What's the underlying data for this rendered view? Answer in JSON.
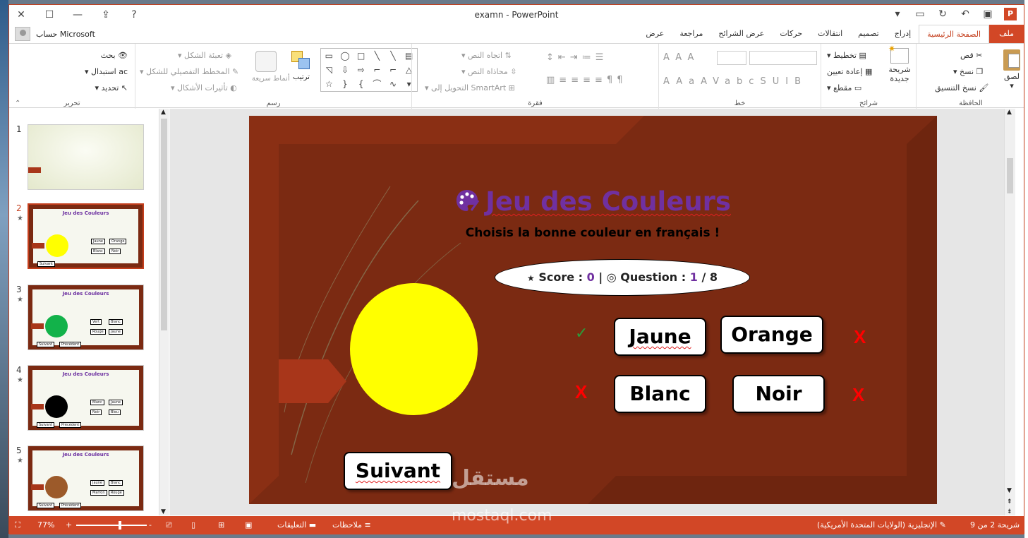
{
  "titlebar": {
    "title": "examn - PowerPoint"
  },
  "account": {
    "label": "حساب Microsoft"
  },
  "tabs": [
    {
      "label": "ملف",
      "kind": "file"
    },
    {
      "label": "الصفحة الرئيسية",
      "kind": "active"
    },
    {
      "label": "إدراج"
    },
    {
      "label": "تصميم"
    },
    {
      "label": "انتقالات"
    },
    {
      "label": "حركات"
    },
    {
      "label": "عرض الشرائح"
    },
    {
      "label": "مراجعة"
    },
    {
      "label": "عرض"
    }
  ],
  "ribbon": {
    "clipboard": {
      "label": "الحافظة",
      "paste": "لصق",
      "cut": "قص",
      "copy": "نسخ",
      "format_painter": "نسخ التنسيق"
    },
    "slides": {
      "label": "شرائح",
      "new_slide": "شريحة جديدة",
      "layout": "تخطيط",
      "reset": "إعادة تعيين",
      "section": "مقطع"
    },
    "font": {
      "label": "خط"
    },
    "paragraph": {
      "label": "فقرة",
      "text_direction": "اتجاه النص",
      "align_text": "محاذاة النص",
      "smartart": "التحويل إلى SmartArt"
    },
    "drawing": {
      "label": "رسم",
      "arrange": "ترتيب",
      "quick_styles": "أنماط سريعة",
      "shape_fill": "تعبئة الشكل",
      "shape_outline": "المخطط التفصيلي للشكل",
      "shape_effects": "تأثيرات الأشكال"
    },
    "editing": {
      "label": "تحرير",
      "find": "بحث",
      "replace": "استبدال",
      "select": "تحديد"
    }
  },
  "thumbnails": [
    {
      "num": "1",
      "star": "",
      "color": "",
      "title": "",
      "a": [],
      "buttons": []
    },
    {
      "num": "2",
      "star": "★",
      "color": "#ffff00",
      "title": "Jeu des Couleurs",
      "a": [
        "Jaune",
        "Orange",
        "Blanc",
        "Noir"
      ],
      "buttons": [
        "Suivant"
      ]
    },
    {
      "num": "3",
      "star": "★",
      "color": "#12b24a",
      "title": "Jeu des Couleurs",
      "a": [
        "Vert",
        "Blanc",
        "Rouge",
        "Jaune"
      ],
      "buttons": [
        "Suivant",
        "Précédent"
      ]
    },
    {
      "num": "4",
      "star": "★",
      "color": "#000000",
      "title": "Jeu des Couleurs",
      "a": [
        "Blanc",
        "Jaune",
        "Noir",
        "Bleu"
      ],
      "buttons": [
        "Suivant",
        "Précédent"
      ]
    },
    {
      "num": "5",
      "star": "★",
      "color": "#9c5a2a",
      "title": "Jeu des Couleurs",
      "a": [
        "Jaune",
        "Blanc",
        "Marron",
        "Rouge"
      ],
      "buttons": [
        "Suivant",
        "Précédent"
      ]
    }
  ],
  "slide": {
    "title": "Jeu des Couleurs",
    "subtitle": "Choisis la bonne couleur en français !",
    "score_label": "Score : ",
    "score_value": "0",
    "question_label": "Question : ",
    "question_current": "1",
    "question_total": "8",
    "circle_color": "#ffff00",
    "answers": {
      "a1": "Jaune",
      "a2": "Orange",
      "a3": "Blanc",
      "a4": "Noir"
    },
    "marks": {
      "check": "✓",
      "x": "X"
    },
    "next_button": "Suivant"
  },
  "watermark": {
    "ar": "مستقل",
    "en": "mostaql.com"
  },
  "status": {
    "slide_of": "شريحة 2 من 9",
    "language": "الإنجليزية (الولايات المتحدة الأمريكية)",
    "notes": "ملاحظات",
    "comments": "التعليقات",
    "zoom": "77%"
  },
  "colors": {
    "accent": "#d24726",
    "frame": "#7b2a12",
    "title_purple": "#7030a0"
  }
}
